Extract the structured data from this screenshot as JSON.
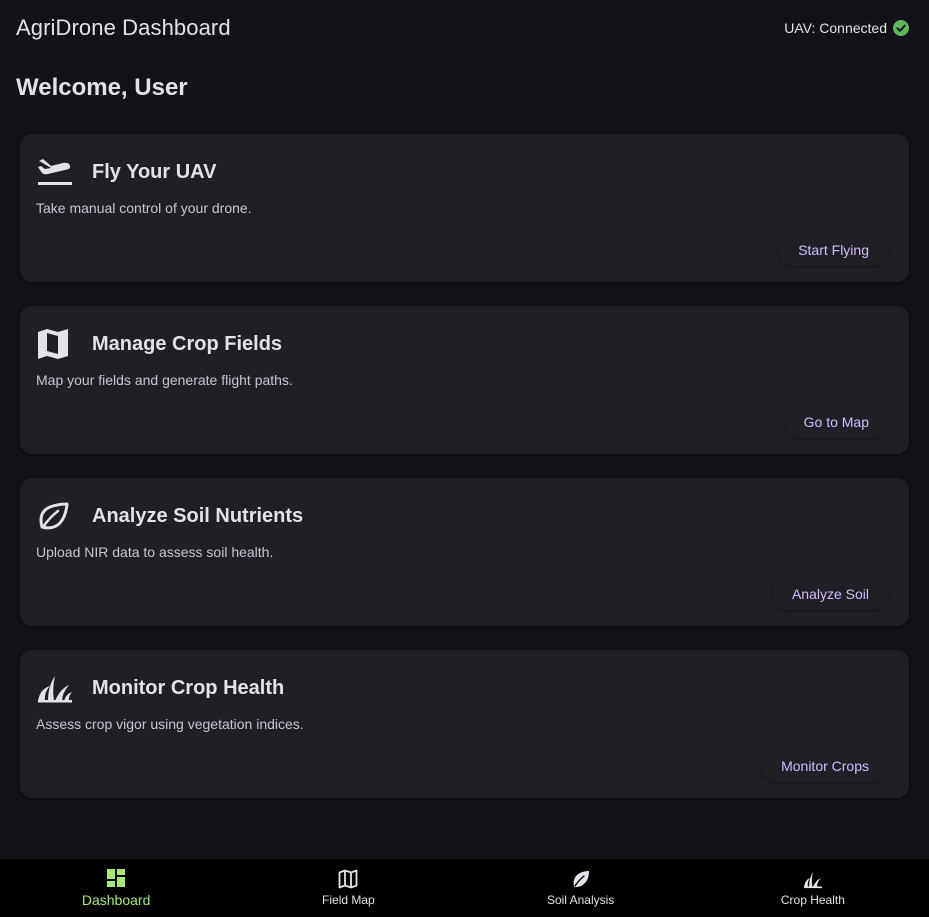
{
  "header": {
    "title": "AgriDrone Dashboard",
    "uav_status": "UAV: Connected",
    "status_icon": "check-circle-icon",
    "status_color": "#5cb85c"
  },
  "welcome": "Welcome, User",
  "cards": [
    {
      "icon": "flight-takeoff-icon",
      "title": "Fly Your UAV",
      "description": "Take manual control of your drone.",
      "action": "Start Flying"
    },
    {
      "icon": "map-icon",
      "title": "Manage Crop Fields",
      "description": "Map your fields and generate flight paths.",
      "action": "Go to Map"
    },
    {
      "icon": "leaf-icon",
      "title": "Analyze Soil Nutrients",
      "description": "Upload NIR data to assess soil health.",
      "action": "Analyze Soil"
    },
    {
      "icon": "grass-icon",
      "title": "Monitor Crop Health",
      "description": "Assess crop vigor using vegetation indices.",
      "action": "Monitor Crops"
    }
  ],
  "bottom_nav": [
    {
      "icon": "dashboard-icon",
      "label": "Dashboard",
      "active": true
    },
    {
      "icon": "map-icon",
      "label": "Field Map",
      "active": false
    },
    {
      "icon": "leaf-icon",
      "label": "Soil Analysis",
      "active": false
    },
    {
      "icon": "grass-icon",
      "label": "Crop Health",
      "active": false
    }
  ],
  "colors": {
    "accent": "#d0bcff",
    "active_nav": "#a6e87a",
    "background": "#141218",
    "card": "#211f26"
  }
}
